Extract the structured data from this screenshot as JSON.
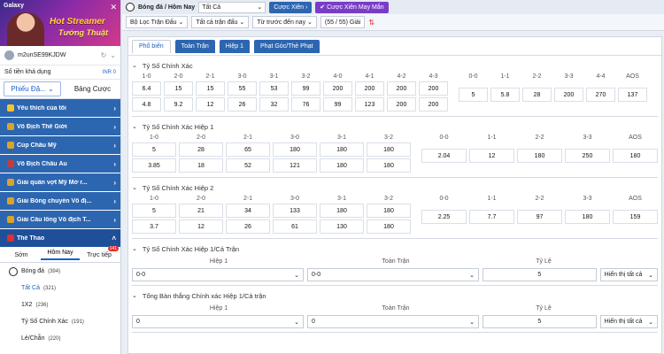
{
  "sidebar": {
    "banner": {
      "brand": "Galaxy",
      "headline": "Hot Streamer",
      "subline": "Tướng Thuật"
    },
    "user": {
      "name": "m2unSE99KJDW"
    },
    "balance": {
      "label": "Số tiền khả dụng",
      "value": "INR 0"
    },
    "tabs": [
      "Phiếu Đặ...",
      "Bảng Cược"
    ],
    "menu": [
      {
        "label": "Yêu thích của tôi",
        "color": "#f3c530"
      },
      {
        "label": "Vô Địch Thế Giới",
        "color": "#d9a42a"
      },
      {
        "label": "Cúp Châu Mỹ",
        "color": "#d9a42a"
      },
      {
        "label": "Vô Địch Châu Âu",
        "color": "#c43c3c"
      },
      {
        "label": "Giải quần vợt Mỹ Mở r...",
        "color": "#d9a42a"
      },
      {
        "label": "Giải Bóng chuyền Vô đị...",
        "color": "#d9a42a"
      },
      {
        "label": "Giải Cầu lông Vô địch T...",
        "color": "#d9a42a"
      },
      {
        "label": "Thể Thao",
        "color": "#e03030"
      }
    ],
    "sport_tabs": [
      "Sớm",
      "Hôm Nay",
      "Trực tiếp"
    ],
    "live_badge": "141",
    "sport": {
      "label": "Bóng đá",
      "count": "(394)"
    },
    "sub_items": [
      {
        "label": "Tất Cả",
        "count": "(321)"
      },
      {
        "label": "1X2",
        "count": "(236)"
      },
      {
        "label": "Tỷ Số Chính Xác",
        "count": "(191)"
      },
      {
        "label": "Lẻ/Chẵn",
        "count": "(220)"
      }
    ]
  },
  "topbar": {
    "title": "Bóng đá / Hôm Nay",
    "select": "Tất Cả",
    "btn_xien": "Cược Xiên",
    "btn_xien_may_man": "Cược Xiên May Mắn"
  },
  "filters": {
    "league": "Bộ Lọc Trận Đấu",
    "all_matches": "Tất cả trận đấu",
    "sort": "Từ trước đến nay",
    "count": "(55 / 55) Giải"
  },
  "main_tabs": [
    "Phổ biến",
    "Toàn Trận",
    "Hiệp 1",
    "Phạt Góc/Thẻ Phạt"
  ],
  "sections": [
    {
      "title": "Tỷ Số Chính Xác",
      "groups": [
        {
          "cols": [
            [
              "1-0",
              "6.4",
              "4.8"
            ],
            [
              "2-0",
              "15",
              "9.2"
            ],
            [
              "2-1",
              "15",
              "12"
            ],
            [
              "3-0",
              "55",
              "26"
            ],
            [
              "3-1",
              "53",
              "32"
            ],
            [
              "3-2",
              "99",
              "76"
            ],
            [
              "4-0",
              "200",
              "99"
            ],
            [
              "4-1",
              "200",
              "123"
            ],
            [
              "4-2",
              "200",
              "200"
            ],
            [
              "4-3",
              "200",
              "200"
            ]
          ]
        },
        {
          "cols": [
            [
              "0-0",
              "5"
            ],
            [
              "1-1",
              "5.8"
            ],
            [
              "2-2",
              "28"
            ],
            [
              "3-3",
              "200"
            ],
            [
              "4-4",
              "270"
            ],
            [
              "AOS",
              "137"
            ]
          ]
        }
      ]
    },
    {
      "title": "Tỷ Số Chính Xác Hiệp 1",
      "groups": [
        {
          "cols": [
            [
              "1-0",
              "5",
              "3.85"
            ],
            [
              "2-0",
              "28",
              "18"
            ],
            [
              "2-1",
              "65",
              "52"
            ],
            [
              "3-0",
              "180",
              "121"
            ],
            [
              "3-1",
              "180",
              "180"
            ],
            [
              "3-2",
              "180",
              "180"
            ]
          ]
        },
        {
          "cols": [
            [
              "0-0",
              "2.04"
            ],
            [
              "1-1",
              "12"
            ],
            [
              "2-2",
              "180"
            ],
            [
              "3-3",
              "250"
            ],
            [
              "AOS",
              "180"
            ]
          ]
        }
      ]
    },
    {
      "title": "Tỷ Số Chính Xác Hiệp 2",
      "groups": [
        {
          "cols": [
            [
              "1-0",
              "5",
              "3.7"
            ],
            [
              "2-0",
              "21",
              "12"
            ],
            [
              "2-1",
              "34",
              "26"
            ],
            [
              "3-0",
              "133",
              "61"
            ],
            [
              "3-1",
              "180",
              "130"
            ],
            [
              "3-2",
              "180",
              "180"
            ]
          ]
        },
        {
          "cols": [
            [
              "0-0",
              "2.25"
            ],
            [
              "1-1",
              "7.7"
            ],
            [
              "2-2",
              "97"
            ],
            [
              "3-3",
              "180"
            ],
            [
              "AOS",
              "159"
            ]
          ]
        }
      ]
    }
  ],
  "forms": [
    {
      "title": "Tỷ Số Chính Xác Hiệp 1/Cả Trận",
      "labels": [
        "Hiệp 1",
        "Toàn Trận",
        "Tỷ Lệ"
      ],
      "values": [
        "0-0",
        "0-0",
        "5"
      ],
      "show_all": "Hiển thị tất cả"
    },
    {
      "title": "Tổng Bàn thắng Chính xác Hiệp 1/Cả trận",
      "labels": [
        "Hiệp 1",
        "Toàn Trận",
        "Tỷ Lệ"
      ],
      "values": [
        "0",
        "0",
        "5"
      ],
      "show_all": "Hiển thị tất cả"
    }
  ]
}
